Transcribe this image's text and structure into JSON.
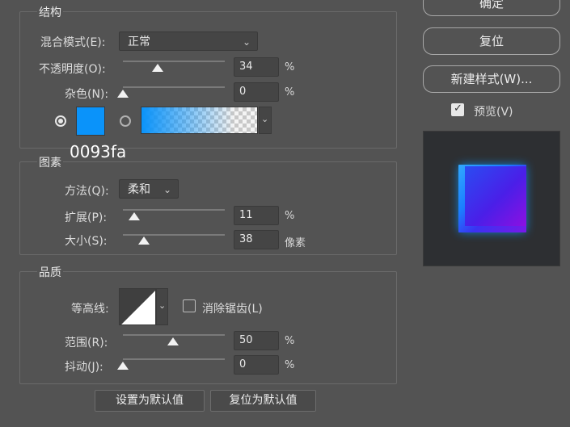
{
  "structure": {
    "title": "结构",
    "blend_mode": {
      "label": "混合模式(E):",
      "value": "正常"
    },
    "opacity": {
      "label": "不透明度(O):",
      "value": "34",
      "unit": "%",
      "fraction": 0.34
    },
    "noise": {
      "label": "杂色(N):",
      "value": "0",
      "unit": "%",
      "fraction": 0.0
    },
    "color_hex": "0093fa",
    "color": "#0093fa"
  },
  "elements": {
    "title": "图素",
    "method": {
      "label": "方法(Q):",
      "value": "柔和"
    },
    "spread": {
      "label": "扩展(P):",
      "value": "11",
      "unit": "%",
      "fraction": 0.11
    },
    "size": {
      "label": "大小(S):",
      "value": "38",
      "unit": "像素",
      "fraction": 0.2
    }
  },
  "quality": {
    "title": "品质",
    "contour_label": "等高线:",
    "antialias_label": "消除锯齿(L)",
    "range": {
      "label": "范围(R):",
      "value": "50",
      "unit": "%",
      "fraction": 0.5
    },
    "jitter": {
      "label": "抖动(J):",
      "value": "0",
      "unit": "%",
      "fraction": 0.0
    }
  },
  "footer": {
    "make_default": "设置为默认值",
    "reset_default": "复位为默认值"
  },
  "side": {
    "ok": "确定",
    "reset": "复位",
    "new_style": "新建样式(W)...",
    "preview": "预览(V)"
  },
  "icons": {
    "chevron": "chevron-down-icon",
    "check": "checkmark-icon"
  }
}
